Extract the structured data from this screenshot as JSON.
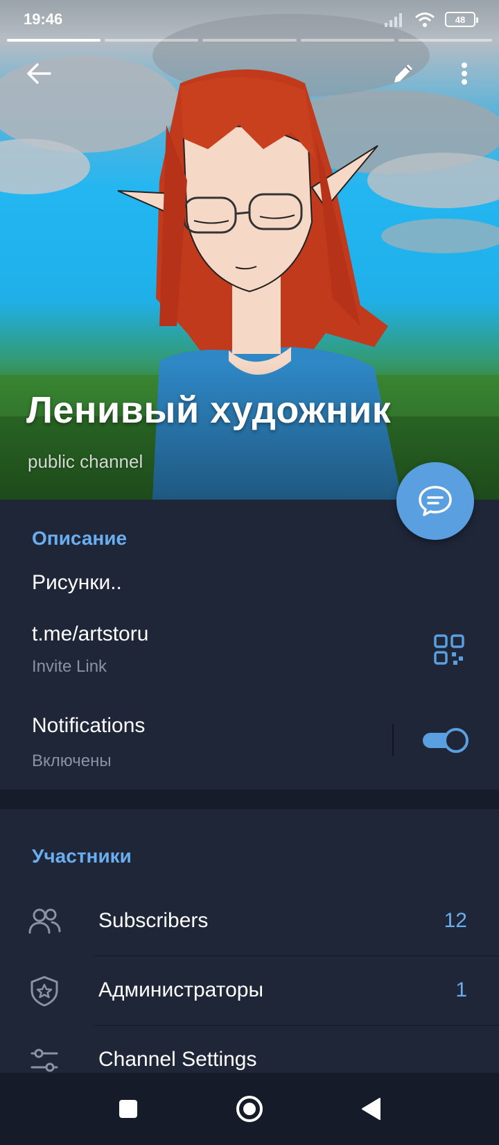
{
  "status_bar": {
    "time": "19:46",
    "battery": "48"
  },
  "header": {
    "story_segments": 5,
    "active_segment": 1
  },
  "channel": {
    "title": "Ленивый художник",
    "subtitle": "public channel"
  },
  "info": {
    "description_heading": "Описание",
    "description": "Рисунки..",
    "link": "t.me/artstoru",
    "link_caption": "Invite Link",
    "notifications_label": "Notifications",
    "notifications_state": "Включены"
  },
  "members": {
    "heading": "Участники",
    "rows": [
      {
        "icon": "people-icon",
        "label": "Subscribers",
        "count": "12"
      },
      {
        "icon": "shield-star-icon",
        "label": "Администраторы",
        "count": "1"
      },
      {
        "icon": "sliders-icon",
        "label": "Channel Settings",
        "count": ""
      }
    ]
  },
  "colors": {
    "accent": "#6aaef0",
    "fab": "#5a9fe0",
    "panel": "#1e2638",
    "navbar": "#151b28"
  }
}
